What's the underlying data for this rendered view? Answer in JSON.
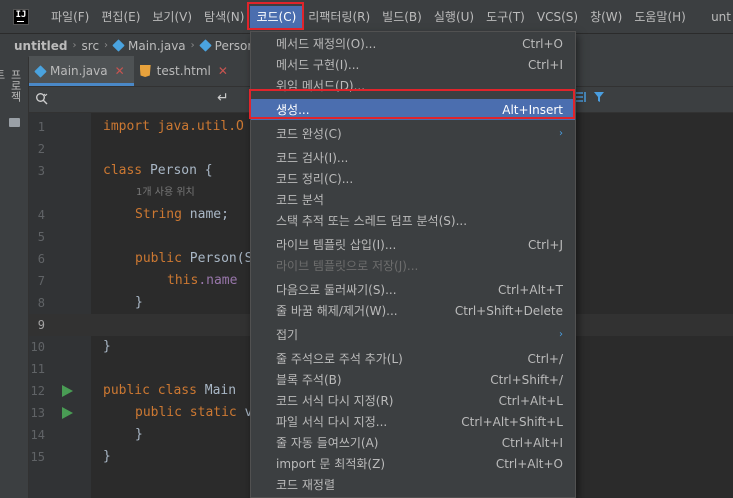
{
  "menubar": {
    "logo": "IJ",
    "items": [
      "파일(F)",
      "편집(E)",
      "보기(V)",
      "탐색(N)",
      "코드(C)",
      "리팩터링(R)",
      "빌드(B)",
      "실행(U)",
      "도구(T)",
      "VCS(S)",
      "창(W)",
      "도움말(H)"
    ],
    "trailing": "unt"
  },
  "breadcrumb": {
    "project": "untitled",
    "src": "src",
    "file": "Main.java",
    "cls": "Person"
  },
  "sidebar": {
    "project_label": "프로젝트"
  },
  "tabs": [
    {
      "label": "Main.java",
      "close": "✕"
    },
    {
      "label": "test.html",
      "close": "✕"
    }
  ],
  "editor": {
    "line_numbers": [
      "1",
      "2",
      "3",
      "4",
      "5",
      "6",
      "7",
      "8",
      "9",
      "10",
      "11",
      "12",
      "13",
      "14",
      "15"
    ],
    "usage_hint": "1개 사용 위치",
    "code": {
      "l1": "import java.util.O",
      "l3_kw": "class ",
      "l3_rest": "Person {",
      "l4_type": "String ",
      "l4_rest": "name;",
      "l6_kw": "public ",
      "l6_rest": "Person(S",
      "l7_kw": "this",
      "l7_fld": ".name ",
      "l8": "}",
      "l10": "}",
      "l12_kw": "public class ",
      "l12_rest": "Main ",
      "l13_kw": "public static ",
      "l13_rest": "v",
      "l14": "}",
      "l15": "}"
    }
  },
  "code_menu": {
    "items": [
      {
        "label": "메서드 재정의(O)...",
        "shortcut": "Ctrl+O"
      },
      {
        "label": "메서드 구현(I)...",
        "shortcut": "Ctrl+I"
      },
      {
        "label": "위임 메서드(D)...",
        "shortcut": ""
      },
      {
        "label": "생성...",
        "shortcut": "Alt+Insert"
      },
      {
        "label": "코드 완성(C)",
        "shortcut": ""
      },
      {
        "label": "코드 검사(I)...",
        "shortcut": ""
      },
      {
        "label": "코드 정리(C)...",
        "shortcut": ""
      },
      {
        "label": "코드 분석",
        "shortcut": ""
      },
      {
        "label": "스택 추적 또는 스레드 덤프 분석(S)...",
        "shortcut": ""
      },
      {
        "label": "라이브 템플릿 삽입(I)...",
        "shortcut": "Ctrl+J"
      },
      {
        "label": "라이브 템플릿으로 저장(J)...",
        "shortcut": ""
      },
      {
        "label": "다음으로 둘러싸기(S)...",
        "shortcut": "Ctrl+Alt+T"
      },
      {
        "label": "줄 바꿈 해제/제거(W)...",
        "shortcut": "Ctrl+Shift+Delete"
      },
      {
        "label": "접기",
        "shortcut": ""
      },
      {
        "label": "줄 주석으로 주석 추가(L)",
        "shortcut": "Ctrl+/"
      },
      {
        "label": "블록 주석(B)",
        "shortcut": "Ctrl+Shift+/"
      },
      {
        "label": "코드 서식 다시 지정(R)",
        "shortcut": "Ctrl+Alt+L"
      },
      {
        "label": "파일 서식 다시 지정...",
        "shortcut": "Ctrl+Alt+Shift+L"
      },
      {
        "label": "줄 자동 들여쓰기(A)",
        "shortcut": "Ctrl+Alt+I"
      },
      {
        "label": "import 문 최적화(Z)",
        "shortcut": "Ctrl+Alt+O"
      },
      {
        "label": "코드 재정렬",
        "shortcut": ""
      }
    ],
    "submenu_arrow": "›"
  },
  "colors": {
    "accent": "#4b6eaf",
    "highlight_box": "#e0242b"
  }
}
